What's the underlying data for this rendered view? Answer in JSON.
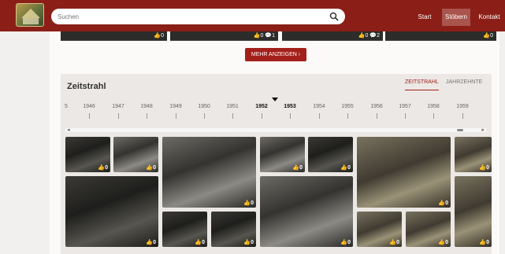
{
  "search": {
    "placeholder": "Suchen"
  },
  "nav": [
    {
      "label": "Start"
    },
    {
      "label": "Stöbern"
    },
    {
      "label": "Kontakt"
    }
  ],
  "top_counts": [
    {
      "likes": "0"
    },
    {
      "likes": "0",
      "comments": "1"
    },
    {
      "likes": "0",
      "comments": "2"
    },
    {
      "likes": "0"
    }
  ],
  "more_label": "MEHR ANZEIGEN",
  "timeline": {
    "title": "Zeitstrahl",
    "tabs": [
      "ZEITSTRAHL",
      "JAHRZEHNTE"
    ],
    "years": [
      "5",
      "1946",
      "1947",
      "1948",
      "1949",
      "1950",
      "1951",
      "1952",
      "1953",
      "1954",
      "1955",
      "1956",
      "1957",
      "1958",
      "1959"
    ],
    "selected_years": [
      "1952",
      "1953"
    ]
  },
  "photo_counts": {
    "p1": "0",
    "p2": "0",
    "p3": "0",
    "p4": "0",
    "p5": "0",
    "p6": "0",
    "p7": "0",
    "p8": "0",
    "p9": "0",
    "p10": "0",
    "p11": "0",
    "p12": "0",
    "p13": "0",
    "p14": "0",
    "p15": "0",
    "p16": "0"
  },
  "colors": {
    "header": "#8b1f17",
    "accent": "#a3201a"
  }
}
